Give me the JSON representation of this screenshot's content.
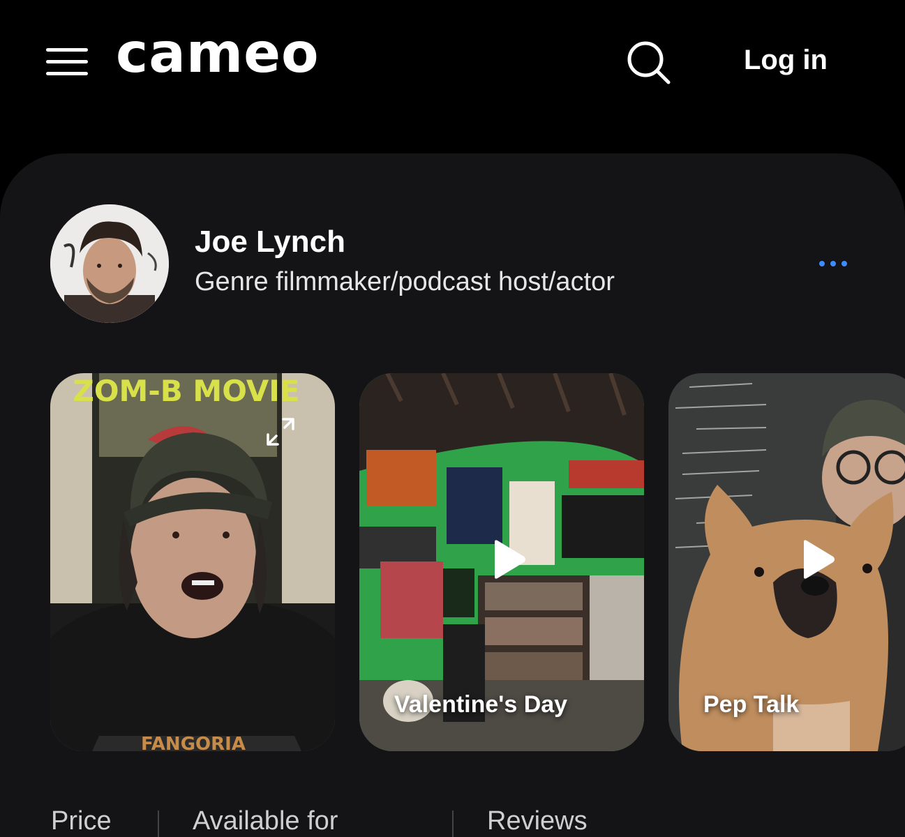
{
  "header": {
    "logo_text": "cameo",
    "login_label": "Log in",
    "menu_icon": "hamburger-icon",
    "search_icon": "search-icon"
  },
  "profile": {
    "name": "Joe Lynch",
    "tagline": "Genre filmmaker/podcast host/actor",
    "more_icon": "more-horizontal-icon",
    "accent_color": "#3d8cff"
  },
  "videos": [
    {
      "label": "",
      "icon": "expand-icon"
    },
    {
      "label": "Valentine's Day",
      "icon": "play-icon"
    },
    {
      "label": "Pep Talk",
      "icon": "play-icon"
    }
  ],
  "video_1_poster_text": "ZOM-B MOVIE",
  "stats": {
    "price_label": "Price",
    "available_label": "Available for",
    "reviews_label": "Reviews"
  }
}
